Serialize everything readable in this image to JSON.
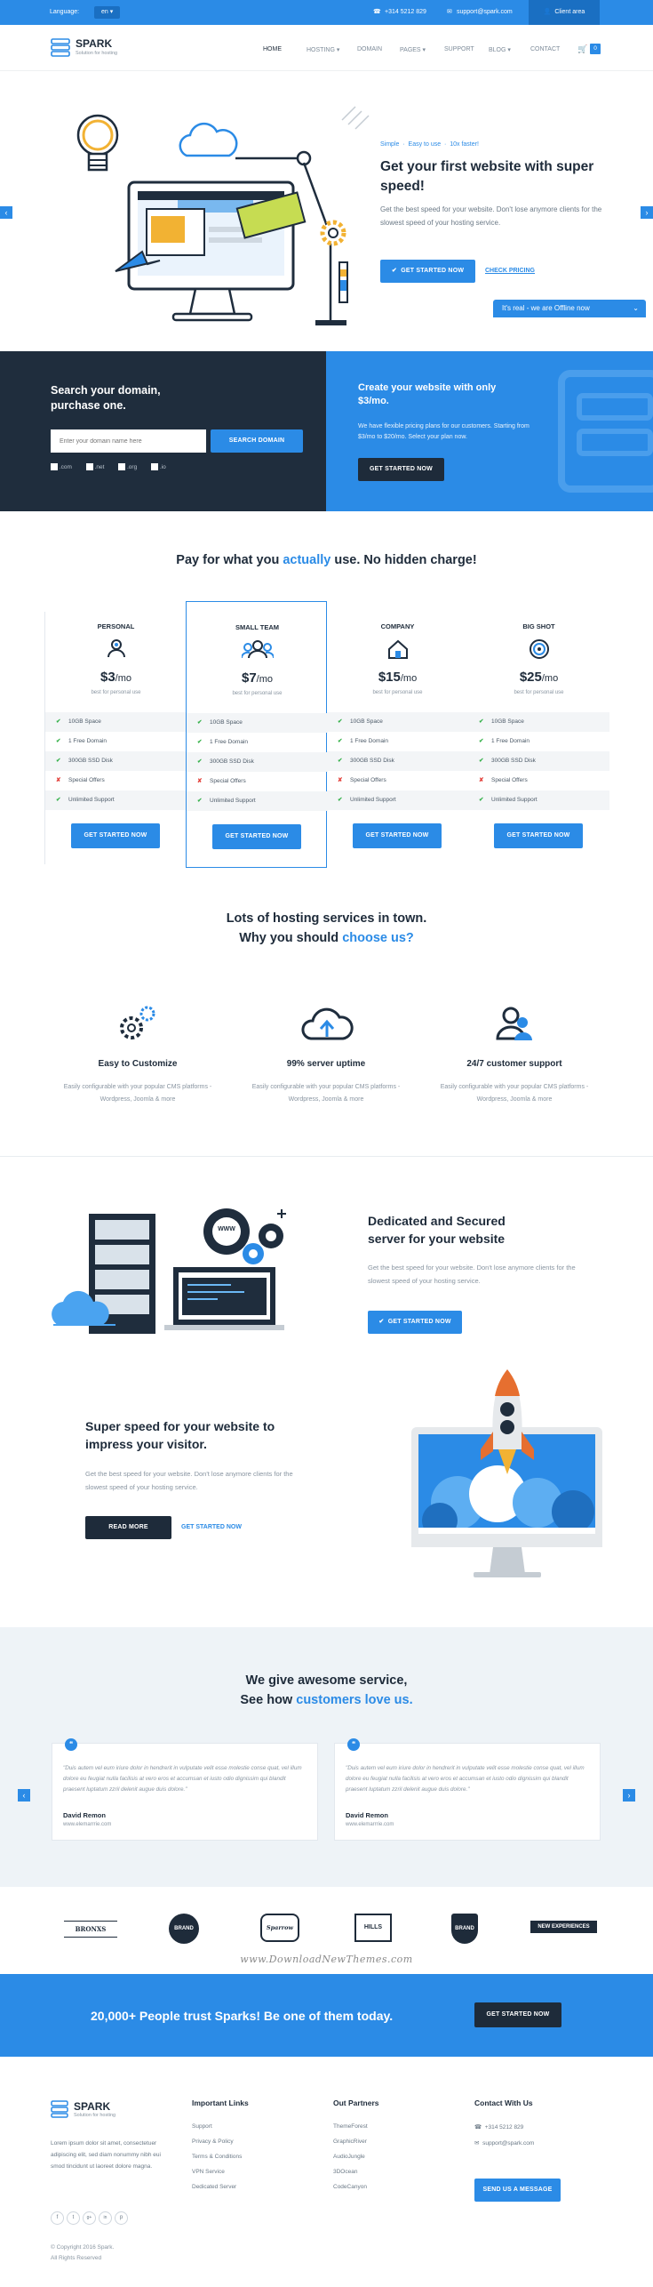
{
  "topbar": {
    "language_label": "Language:",
    "language_value": "en",
    "phone": "+314 5212 829",
    "email": "support@spark.com",
    "client_area": "Client area"
  },
  "header": {
    "brand": "SPARK",
    "tagline": "Solution for hosting",
    "nav": [
      "HOME",
      "HOSTING",
      "DOMAIN",
      "PAGES",
      "SUPPORT",
      "BLOG",
      "CONTACT"
    ],
    "cart_count": "0"
  },
  "hero": {
    "breadcrumb": [
      "Simple",
      "Easy to use",
      "10x faster!"
    ],
    "title": "Get your first website with super speed!",
    "text": "Get the best speed for your website. Don't lose anymore clients for the slowest speed of your hosting service.",
    "cta": "GET STARTED NOW",
    "link": "CHECK PRICING",
    "chat": "It's real - we are Offline now"
  },
  "domain_search": {
    "title": "Search your domain, purchase one.",
    "placeholder": "Enter your domain name here",
    "button": "SEARCH DOMAIN",
    "tlds": [
      ".com",
      ".net",
      ".org",
      ".io"
    ]
  },
  "promo": {
    "title": "Create your website with only $3/mo.",
    "text": "We have flexible pricing plans for our customers. Starting from $3/mo to $20/mo. Select your plan now.",
    "button": "GET STARTED NOW"
  },
  "pricing": {
    "heading_a": "Pay for what you",
    "heading_b": "actually",
    "heading_c": "use. No hidden charge!",
    "plans": [
      {
        "name": "PERSONAL",
        "price": "$3",
        "per": "/mo",
        "sub": "best for personal use",
        "button": "GET STARTED NOW"
      },
      {
        "name": "SMALL TEAM",
        "price": "$7",
        "per": "/mo",
        "sub": "best for personal use",
        "button": "GET STARTED NOW"
      },
      {
        "name": "COMPANY",
        "price": "$15",
        "per": "/mo",
        "sub": "best for personal use",
        "button": "GET STARTED NOW"
      },
      {
        "name": "BIG SHOT",
        "price": "$25",
        "per": "/mo",
        "sub": "best for personal use",
        "button": "GET STARTED NOW"
      }
    ],
    "features": [
      "10GB Space",
      "1 Free Domain",
      "300GB SSD Disk",
      "Special Offers",
      "Unlimited Support"
    ]
  },
  "why": {
    "line1": "Lots of hosting services in town.",
    "line2a": "Why you should",
    "line2b": "choose us?",
    "items": [
      {
        "title": "Easy to Customize",
        "text": "Easily configurable with your popular CMS platforms - Wordpress, Joomla & more"
      },
      {
        "title": "99% server uptime",
        "text": "Easily configurable with your popular CMS platforms - Wordpress, Joomla & more"
      },
      {
        "title": "24/7 customer support",
        "text": "Easily configurable with your popular CMS platforms - Wordpress, Joomla & more"
      }
    ]
  },
  "dedicated": {
    "title": "Dedicated and Secured server for your website",
    "text": "Get the best speed for your website. Don't lose anymore clients for the slowest speed of your hosting service.",
    "button": "GET STARTED NOW",
    "www": "WWW"
  },
  "speed": {
    "title": "Super speed for your website to impress your visitor.",
    "text": "Get the best speed for your website. Don't lose anymore clients for the slowest speed of your hosting service.",
    "read_more": "READ MORE",
    "link": "GET STARTED NOW"
  },
  "testimonials": {
    "line1": "We give awesome service,",
    "line2a": "See how",
    "line2b": "customers love us.",
    "items": [
      {
        "quote": "\"Duis autem vel eum iriure dolor in hendrerit in vulputate velit esse molestie conse quat, vel illum dolore eu feugiat nulla facilisis at vero eros et accumsan et iusto odio dignissim qui blandit praesent luptatum zzril delenit augue duis dolore.\"",
        "name": "David Remon",
        "site": "www.elemarrrie.com"
      },
      {
        "quote": "\"Duis autem vel eum iriure dolor in hendrerit in vulputate velit esse molestie conse quat, vel illum dolore eu feugiat nulla facilisis at vero eros et accumsan et iusto odio dignissim qui blandit praesent luptatum zzril delenit augue duis dolore.\"",
        "name": "David Remon",
        "site": "www.elemarrrie.com"
      }
    ]
  },
  "logos": [
    "BRONXS",
    "BRAND",
    "Sparrow",
    "HILLS",
    "BRAND",
    "NEW EXPERIENCES"
  ],
  "watermark": "www.DownloadNewThemes.com",
  "trust": {
    "text": "20,000+ People trust Sparks! Be one of them today.",
    "button": "GET STARTED NOW"
  },
  "footer": {
    "brand": "SPARK",
    "tagline": "Solution for hosting",
    "about": "Lorem ipsum dolor sit amet, consectetuer adipiscing elit, sed diam nonummy nibh eui smod tincidunt ut laoreet dolore magna.",
    "social": [
      "f",
      "t",
      "g+",
      "in",
      "p"
    ],
    "copyright": "© Copyright 2016 Spark.",
    "rights": "All Rights Reserved",
    "links_title": "Important Links",
    "links": [
      "Support",
      "Privacy & Policy",
      "Terms & Conditions",
      "VPN Service",
      "Dedicated Server"
    ],
    "partners_title": "Out Partners",
    "partners": [
      "ThemeForest",
      "GraphicRiver",
      "AudioJungle",
      "3DOcean",
      "CodeCanyon"
    ],
    "contact_title": "Contact With Us",
    "phone": "+314 5212 829",
    "email": "support@spark.com",
    "button": "SEND US A MESSAGE"
  },
  "colors": {
    "accent": "#2b8be6",
    "dark": "#1f2d3d",
    "check": "#35b14a",
    "cross": "#e3413a"
  }
}
